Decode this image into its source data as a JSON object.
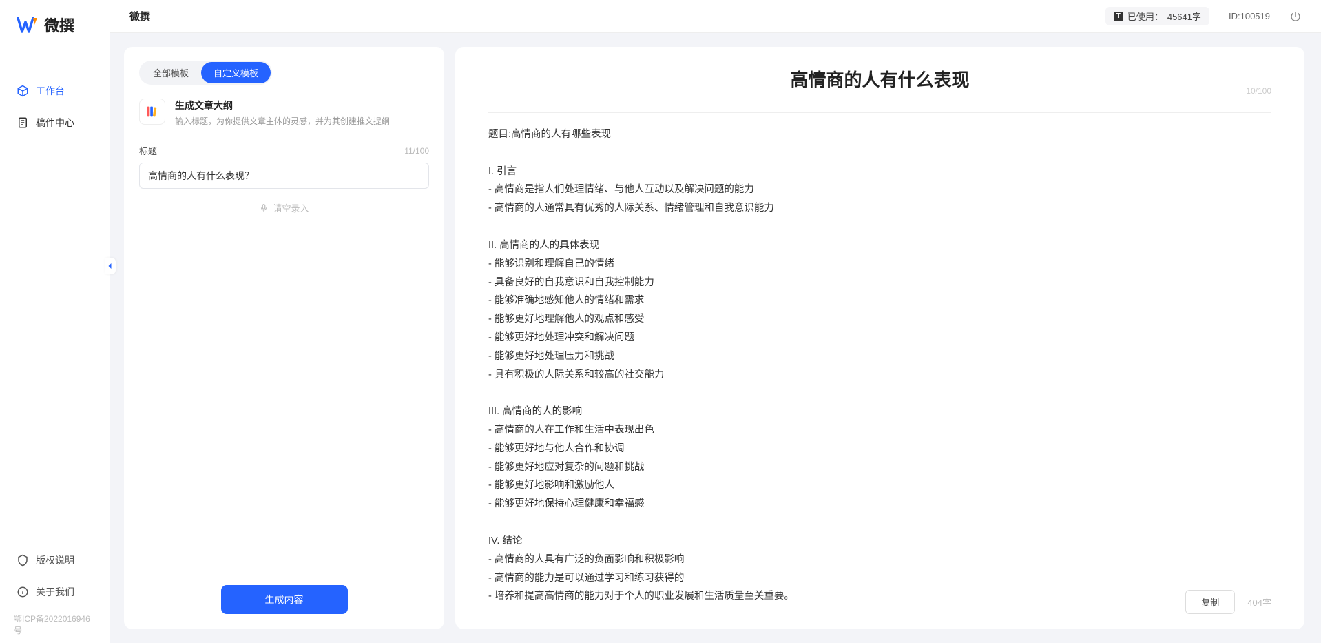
{
  "app": {
    "name": "微撰"
  },
  "topbar": {
    "title": "微撰",
    "usage_prefix": "已使用：",
    "usage_value": "45641字",
    "id_label": "ID:100519"
  },
  "sidebar": {
    "nav": [
      {
        "label": "工作台",
        "icon": "cube-icon",
        "active": true
      },
      {
        "label": "稿件中心",
        "icon": "document-icon",
        "active": false
      }
    ],
    "bottom": [
      {
        "label": "版权说明",
        "icon": "shield-icon"
      },
      {
        "label": "关于我们",
        "icon": "info-icon"
      }
    ],
    "icp": "鄂ICP备2022016946号"
  },
  "leftPanel": {
    "tabs": [
      {
        "label": "全部模板",
        "active": false
      },
      {
        "label": "自定义模板",
        "active": true
      }
    ],
    "template": {
      "title": "生成文章大纲",
      "desc": "输入标题，为你提供文章主体的灵感，并为其创建推文提纲"
    },
    "field_label": "标题",
    "field_count": "11/100",
    "input_value": "高情商的人有什么表现？",
    "voice_hint": "请空录入",
    "generate_button": "生成内容"
  },
  "rightPanel": {
    "title": "高情商的人有什么表现",
    "title_count": "10/100",
    "body": "题目:高情商的人有哪些表现\n\nI. 引言\n- 高情商是指人们处理情绪、与他人互动以及解决问题的能力\n- 高情商的人通常具有优秀的人际关系、情绪管理和自我意识能力\n\nII. 高情商的人的具体表现\n- 能够识别和理解自己的情绪\n- 具备良好的自我意识和自我控制能力\n- 能够准确地感知他人的情绪和需求\n- 能够更好地理解他人的观点和感受\n- 能够更好地处理冲突和解决问题\n- 能够更好地处理压力和挑战\n- 具有积极的人际关系和较高的社交能力\n\nIII. 高情商的人的影响\n- 高情商的人在工作和生活中表现出色\n- 能够更好地与他人合作和协调\n- 能够更好地应对复杂的问题和挑战\n- 能够更好地影响和激励他人\n- 能够更好地保持心理健康和幸福感\n\nIV. 结论\n- 高情商的人具有广泛的负面影响和积极影响\n- 高情商的能力是可以通过学习和练习获得的\n- 培养和提高高情商的能力对于个人的职业发展和生活质量至关重要。",
    "copy_button": "复制",
    "word_count": "404字"
  }
}
